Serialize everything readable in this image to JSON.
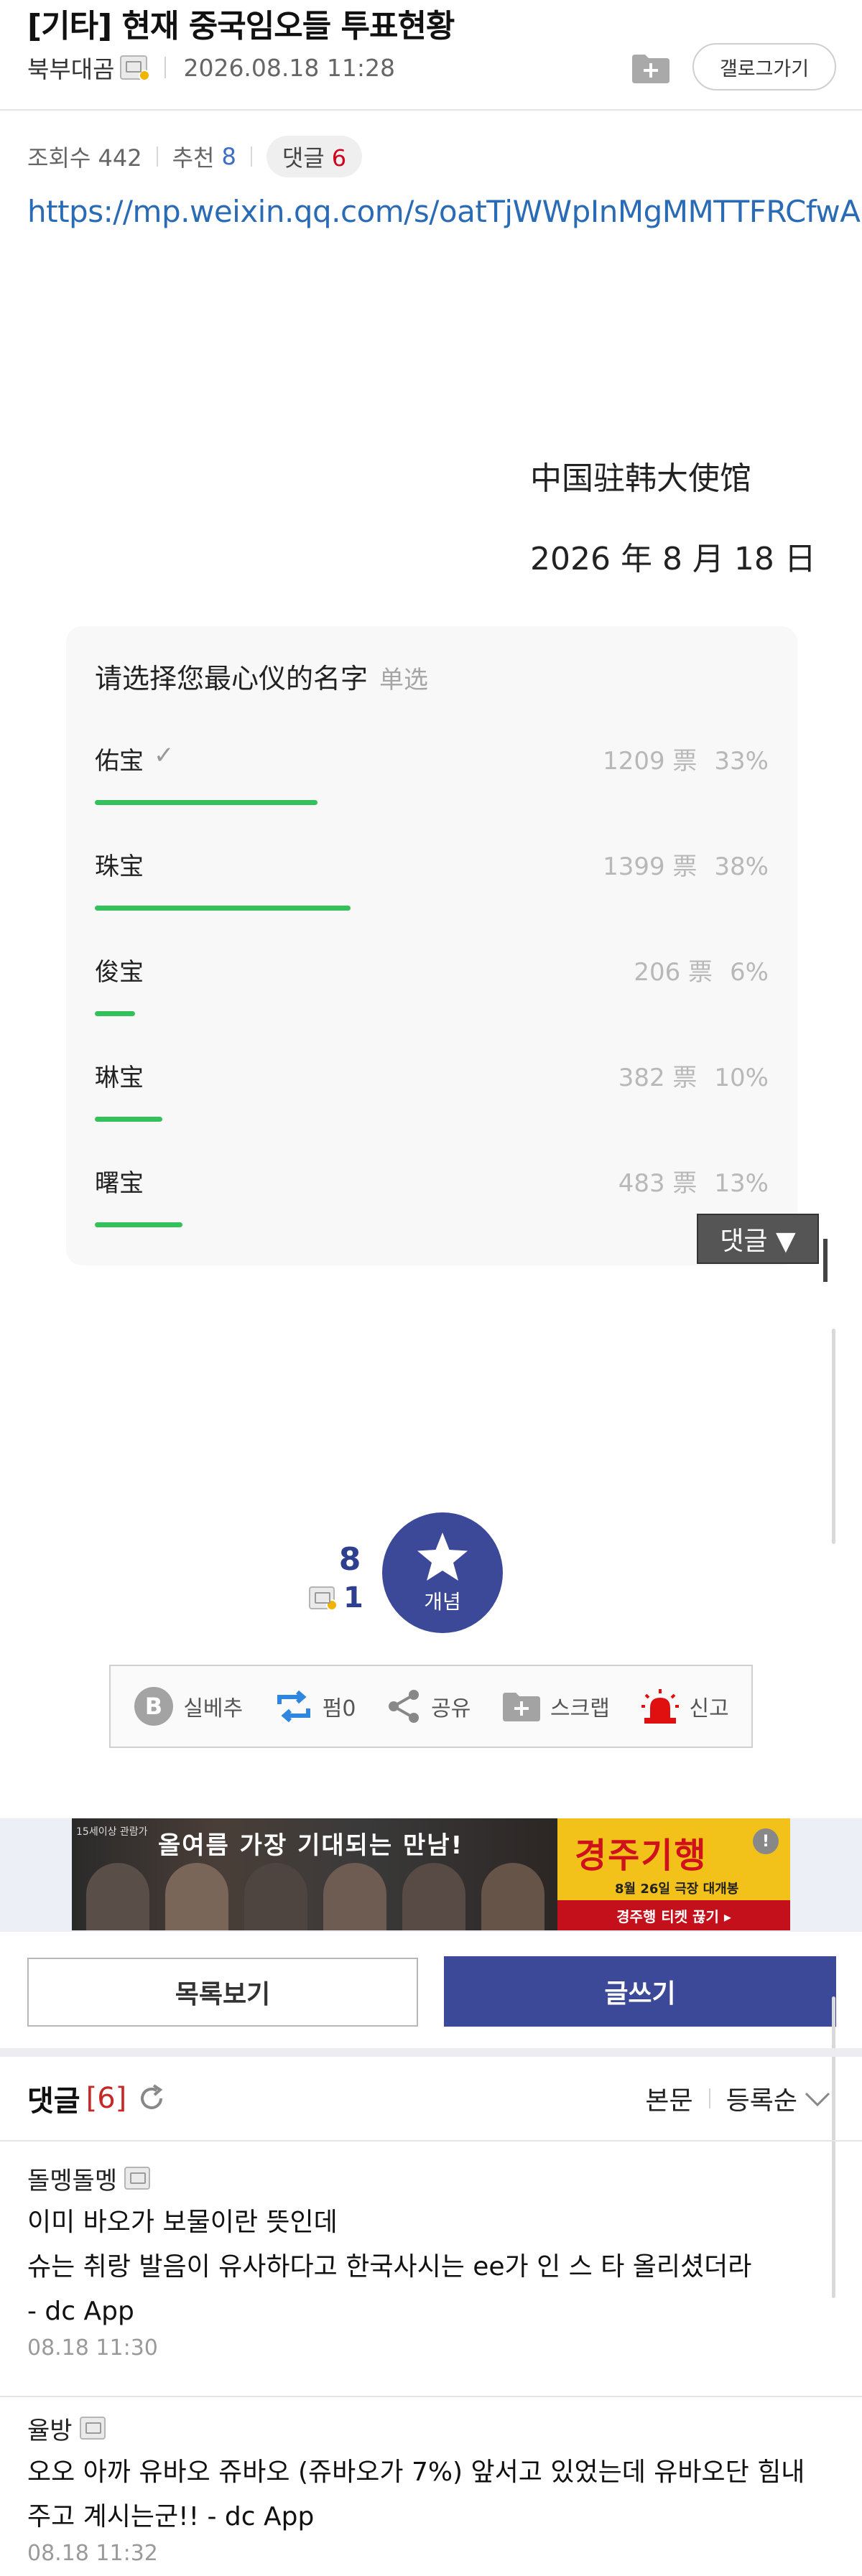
{
  "post": {
    "title": "[기타] 현재 중국임오들 투표현황",
    "author": "북부대곰",
    "date": "2026.08.18 11:28",
    "gallery_button": "갤로그가기",
    "views_label": "조회수 442",
    "recommend_label": "추천",
    "recommend_count": "8",
    "comment_label": "댓글",
    "comment_count": "6",
    "link": "https://mp.weixin.qq.com/s/oatTjWWpInMgMMTTFRCfwA"
  },
  "poll_image": {
    "embassy": "中国驻韩大使馆",
    "date": "2026 年 8 月 18 日",
    "question": "请选择您最心仪的名字",
    "mode": "单选",
    "options": [
      {
        "name": "佑宝",
        "checked": true,
        "votes": "1209 票",
        "percent": "33%",
        "fraction": 0.33
      },
      {
        "name": "珠宝",
        "checked": false,
        "votes": "1399 票",
        "percent": "38%",
        "fraction": 0.38
      },
      {
        "name": "俊宝",
        "checked": false,
        "votes": "206 票",
        "percent": "6%",
        "fraction": 0.06
      },
      {
        "name": "琳宝",
        "checked": false,
        "votes": "382 票",
        "percent": "10%",
        "fraction": 0.1
      },
      {
        "name": "曙宝",
        "checked": false,
        "votes": "483 票",
        "percent": "13%",
        "fraction": 0.13
      }
    ],
    "bar_color": "#34c05a"
  },
  "comment_jump": "댓글 ▼",
  "recommend": {
    "count": "8",
    "fixed_count": "1",
    "button_label": "개념"
  },
  "actions": [
    {
      "name": "realbest",
      "icon": "b-circle-icon",
      "label": "실베추"
    },
    {
      "name": "share-retweet",
      "icon": "retweet-icon",
      "label": "펌0"
    },
    {
      "name": "share",
      "icon": "share-icon",
      "label": "공유"
    },
    {
      "name": "scrap",
      "icon": "folder-plus-icon",
      "label": "스크랩"
    },
    {
      "name": "report",
      "icon": "siren-icon",
      "label": "신고"
    }
  ],
  "ad": {
    "rating": "15세이상 관람가",
    "headline": "올여름 가장 기대되는 만남!",
    "title": "경주기행",
    "subtitle": "8월 26일 극장 대개봉",
    "cta": "경주행 티켓 끊기 ▸",
    "info": "!"
  },
  "buttons": {
    "list": "목록보기",
    "write": "글쓰기"
  },
  "comments_section": {
    "title": "댓글",
    "count": "[6]",
    "sort_body": "본문",
    "sort_order": "등록순"
  },
  "comments": [
    {
      "author": "돌멩돌멩",
      "lines": [
        "이미 바오가 보물이란 뜻인데",
        "슈는 취랑 발음이 유사하다고 한국사시는 ee가 인 스 타 올리셨더라",
        "- dc App"
      ],
      "time": "08.18 11:30"
    },
    {
      "author": "율방",
      "lines": [
        "오오 아까 유바오 쥬바오 (쥬바오가 7%) 앞서고 있었는데 유바오단 힘내",
        "주고 계시는군!! - dc App"
      ],
      "time": "08.18 11:32"
    }
  ],
  "colors": {
    "brand": "#3b4998",
    "link": "#2a6bb5",
    "accent_red": "#d0021b"
  }
}
